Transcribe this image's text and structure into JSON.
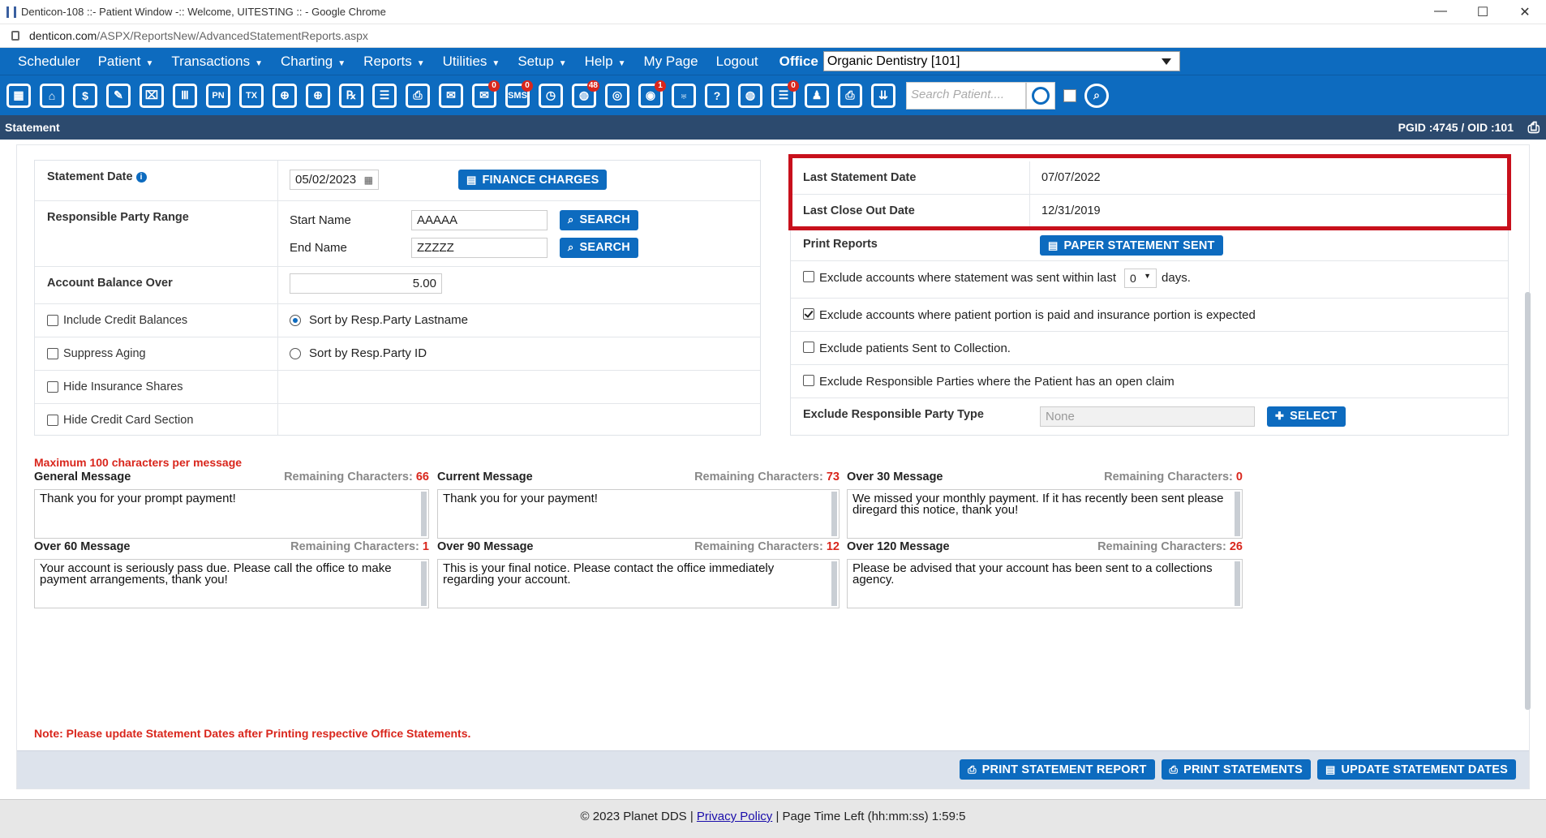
{
  "window": {
    "title": "Denticon-108 ::- Patient Window -:: Welcome, UITESTING :: - Google Chrome",
    "url_host": "denticon.com",
    "url_path": "/ASPX/ReportsNew/AdvancedStatementReports.aspx",
    "controls": {
      "minimize": "—",
      "maximize": "☐",
      "close": "✕"
    }
  },
  "menu": {
    "items": [
      {
        "label": "Scheduler",
        "caret": ""
      },
      {
        "label": "Patient",
        "caret": "▼"
      },
      {
        "label": "Transactions",
        "caret": "▼"
      },
      {
        "label": "Charting",
        "caret": "▼"
      },
      {
        "label": "Reports",
        "caret": "▼"
      },
      {
        "label": "Utilities",
        "caret": "▼"
      },
      {
        "label": "Setup",
        "caret": "▼"
      },
      {
        "label": "Help",
        "caret": "▼"
      },
      {
        "label": "My Page",
        "caret": ""
      },
      {
        "label": "Logout",
        "caret": ""
      }
    ],
    "office_label": "Office",
    "office_value": "Organic Dentistry [101]"
  },
  "toolbar": {
    "icons": [
      {
        "name": "calendar-icon",
        "glyph": "▦",
        "badge": ""
      },
      {
        "name": "home-icon",
        "glyph": "⌂",
        "badge": ""
      },
      {
        "name": "dollar-icon",
        "glyph": "$",
        "badge": ""
      },
      {
        "name": "edit-icon",
        "glyph": "✎",
        "badge": ""
      },
      {
        "name": "tooth-chart-icon",
        "glyph": "⌧",
        "badge": ""
      },
      {
        "name": "perio-icon",
        "glyph": "Ⅲ",
        "badge": ""
      },
      {
        "name": "pn-icon",
        "glyph": "PN",
        "badge": ""
      },
      {
        "name": "tx-icon",
        "glyph": "TX",
        "badge": ""
      },
      {
        "name": "add-patient-icon",
        "glyph": "⊕",
        "badge": ""
      },
      {
        "name": "add-family-icon",
        "glyph": "⊕",
        "badge": ""
      },
      {
        "name": "rx-icon",
        "glyph": "℞",
        "badge": ""
      },
      {
        "name": "notes-icon",
        "glyph": "☰",
        "badge": ""
      },
      {
        "name": "print-forms-icon",
        "glyph": "⎙",
        "badge": ""
      },
      {
        "name": "mail-icon",
        "glyph": "✉",
        "badge": ""
      },
      {
        "name": "messages-icon",
        "glyph": "✉",
        "badge": "0"
      },
      {
        "name": "sms-icon",
        "glyph": "SMS",
        "badge": "0"
      },
      {
        "name": "clock-icon",
        "glyph": "◷",
        "badge": ""
      },
      {
        "name": "globe-icon",
        "glyph": "◍",
        "badge": "48"
      },
      {
        "name": "support-icon",
        "glyph": "◎",
        "badge": ""
      },
      {
        "name": "reminder-icon",
        "glyph": "◉",
        "badge": "1"
      },
      {
        "name": "tooth-icon",
        "glyph": "♅",
        "badge": ""
      },
      {
        "name": "help-tooth-icon",
        "glyph": "?",
        "badge": ""
      },
      {
        "name": "web-icon",
        "glyph": "◍",
        "badge": ""
      },
      {
        "name": "claims-icon",
        "glyph": "☰",
        "badge": "0"
      },
      {
        "name": "family-icon",
        "glyph": "♟",
        "badge": ""
      },
      {
        "name": "printer-icon",
        "glyph": "⎙",
        "badge": ""
      },
      {
        "name": "download-icon",
        "glyph": "⇊",
        "badge": ""
      }
    ],
    "search_placeholder": "Search Patient...."
  },
  "statusbar": {
    "title": "Statement",
    "ids": "PGID :4745  /  OID :101"
  },
  "form": {
    "statement_date_label": "Statement Date",
    "statement_date_value": "05/02/2023",
    "finance_charges_btn": "FINANCE CHARGES",
    "resp_party_range_label": "Responsible Party Range",
    "start_name_label": "Start Name",
    "start_name_value": "AAAAA",
    "end_name_label": "End Name",
    "end_name_value": "ZZZZZ",
    "search_btn": "SEARCH",
    "account_balance_label": "Account Balance Over",
    "account_balance_value": "5.00",
    "include_credit": "Include Credit Balances",
    "suppress_aging": "Suppress Aging",
    "hide_insurance": "Hide Insurance Shares",
    "hide_credit_card": "Hide Credit Card Section",
    "sort_lastname": "Sort by Resp.Party Lastname",
    "sort_id": "Sort by Resp.Party ID"
  },
  "right": {
    "last_statement_label": "Last Statement Date",
    "last_statement_value": "07/07/2022",
    "last_closeout_label": "Last Close Out Date",
    "last_closeout_value": "12/31/2019",
    "print_reports_label": "Print Reports",
    "paper_statement_btn": "PAPER STATEMENT SENT",
    "exclude_sent_pre": "Exclude accounts where statement was sent within last",
    "exclude_sent_days_value": "0",
    "exclude_sent_post": "days.",
    "exclude_paid": "Exclude accounts where patient portion is paid and insurance portion is expected",
    "exclude_collection": "Exclude patients Sent to Collection.",
    "exclude_open_claim": "Exclude Responsible Parties where the Patient has an open claim",
    "exclude_type_label": "Exclude Responsible Party Type",
    "exclude_type_value": "None",
    "select_btn": "SELECT"
  },
  "messages": {
    "max_note": "Maximum 100 characters per message",
    "remaining_label": "Remaining Characters: ",
    "items": [
      {
        "title": "General Message",
        "remaining": "66",
        "text": "Thank you for your prompt payment!"
      },
      {
        "title": "Current Message",
        "remaining": "73",
        "text": "Thank you for your payment!"
      },
      {
        "title": "Over 30 Message",
        "remaining": "0",
        "text": "We missed your monthly payment. If it has recently been sent please diregard this notice, thank you!"
      },
      {
        "title": "Over 60 Message",
        "remaining": "1",
        "text": "Your account is seriously pass due. Please call the office to make payment arrangements, thank you!"
      },
      {
        "title": "Over 90 Message",
        "remaining": "12",
        "text": "This is your final notice. Please contact the office immediately regarding your account."
      },
      {
        "title": "Over 120 Message",
        "remaining": "26",
        "text": "Please be advised that your account has been sent to a collections agency."
      }
    ]
  },
  "note": "Note: Please update Statement Dates after Printing respective Office Statements.",
  "actions": {
    "print_report": "PRINT STATEMENT REPORT",
    "print_statements": "PRINT STATEMENTS",
    "update_dates": "UPDATE STATEMENT DATES"
  },
  "footer": {
    "copyright": "© 2023 Planet DDS |",
    "privacy": "Privacy Policy",
    "time_left": "|  Page Time Left (hh:mm:ss) 1:59:5"
  },
  "colors": {
    "primary": "#0d6bbf",
    "highlight": "#c8101c",
    "alert": "#d9261c"
  }
}
